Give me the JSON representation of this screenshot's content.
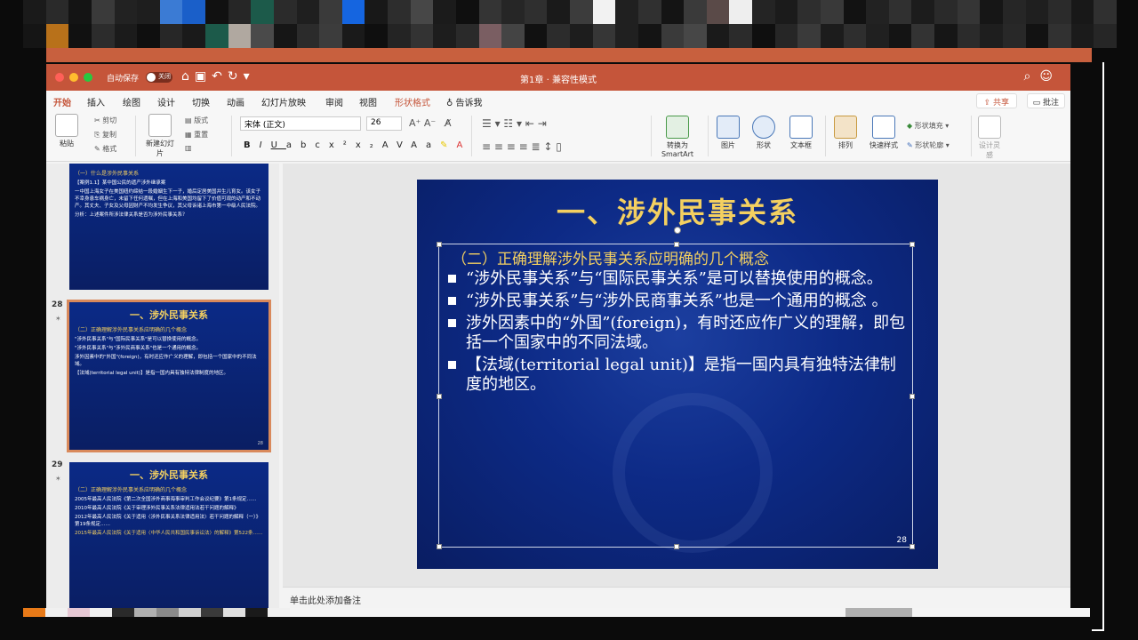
{
  "window": {
    "autosave_label": "自动保存",
    "autosave_state": "关闭",
    "doc_title": "第1章 · 兼容性模式"
  },
  "tabs": [
    "开始",
    "插入",
    "绘图",
    "设计",
    "切换",
    "动画",
    "幻灯片放映",
    "审阅",
    "视图",
    "形状格式",
    "告诉我"
  ],
  "active_tab": "开始",
  "actions": {
    "share": "共享",
    "comment": "批注"
  },
  "ribbon": {
    "paste": "粘贴",
    "cut": "剪切",
    "copy": "复制",
    "format": "格式",
    "new_slide": "新建幻灯片",
    "layout": "版式",
    "reset": "重置",
    "font_name": "宋体 (正文)",
    "font_size": "26",
    "convert_smartart": "转换为SmartArt",
    "picture": "图片",
    "shape": "形状",
    "textbox": "文本框",
    "arrange": "排列",
    "quick_styles": "快速样式",
    "shape_fill": "形状填充",
    "shape_outline": "形状轮廓",
    "design_ideas": "设计灵感"
  },
  "thumbnails": [
    {
      "number": "",
      "subtitle": "（一）什么是涉外民事关系",
      "lines": [
        "【案例1.1】某中国公民的遗产涉外继承案",
        "一中国上海女子在美国纽约缔结一段婚姻生下一子，婚后定居美国并生儿育女。该女子不幸身患车祸身亡，未留下任何遗嘱，但在上海和美国均留下了价值可观的动产和不动产。其丈夫、子女及父母因财产不均发生争议，其父母诉诸上海市第一中级人民法院。",
        "分析：上述案件所涉法律关系是否为涉外民事关系？"
      ]
    },
    {
      "number": "28",
      "title": "一、涉外民事关系",
      "subtitle": "（二）正确理解涉外民事关系应明确的几个概念",
      "lines": [
        "\"涉外民事关系\"与\"国际民事关系\"是可以替换使用的概念。",
        "\"涉外民事关系\"与\"涉外民商事关系\"也是一个通用的概念。",
        "涉外因素中的\"外国\"(foreign)，有时还应作广义的理解，即包括一个国家中的不同法域。",
        "【法域(territorial legal unit)】是指一国内具有独特法律制度的地区。"
      ]
    },
    {
      "number": "29",
      "title": "一、涉外民事关系",
      "subtitle": "（二）正确理解涉外民事关系应明确的几个概念",
      "lines": [
        "2005年最高人民法院《第二次全国涉外商事海事审判工作会议纪要》第1条规定……",
        "2010年最高人民法院《关于审理涉外民事关系法律适用法若干问题的解释》",
        "2012年最高人民法院《关于适用〈涉外民事关系法律适用法〉若干问题的解释（一）》第19条规定……",
        "2015年最高人民法院《关于适用〈中华人民共和国民事诉讼法〉的解释》第522条……"
      ]
    }
  ],
  "slide": {
    "title": "一、涉外民事关系",
    "subtitle": "（二）正确理解涉外民事关系应明确的几个概念",
    "bullets": [
      "“涉外民事关系”与“国际民事关系”是可以替换使用的概念。",
      " “涉外民事关系”与“涉外民商事关系”也是一个通用的概念 。",
      " 涉外因素中的“外国”(foreign)，有时还应作广义的理解，即包括一个国家中的不同法域。",
      "【法域(territorial legal unit)】是指一国内具有独特法律制度的地区。"
    ],
    "page_number": "28"
  },
  "notes_placeholder": "单击此处添加备注",
  "colors": {
    "accent": "#c5553a",
    "slide_title": "#f4d060",
    "slide_bg": "#0d2a86"
  }
}
